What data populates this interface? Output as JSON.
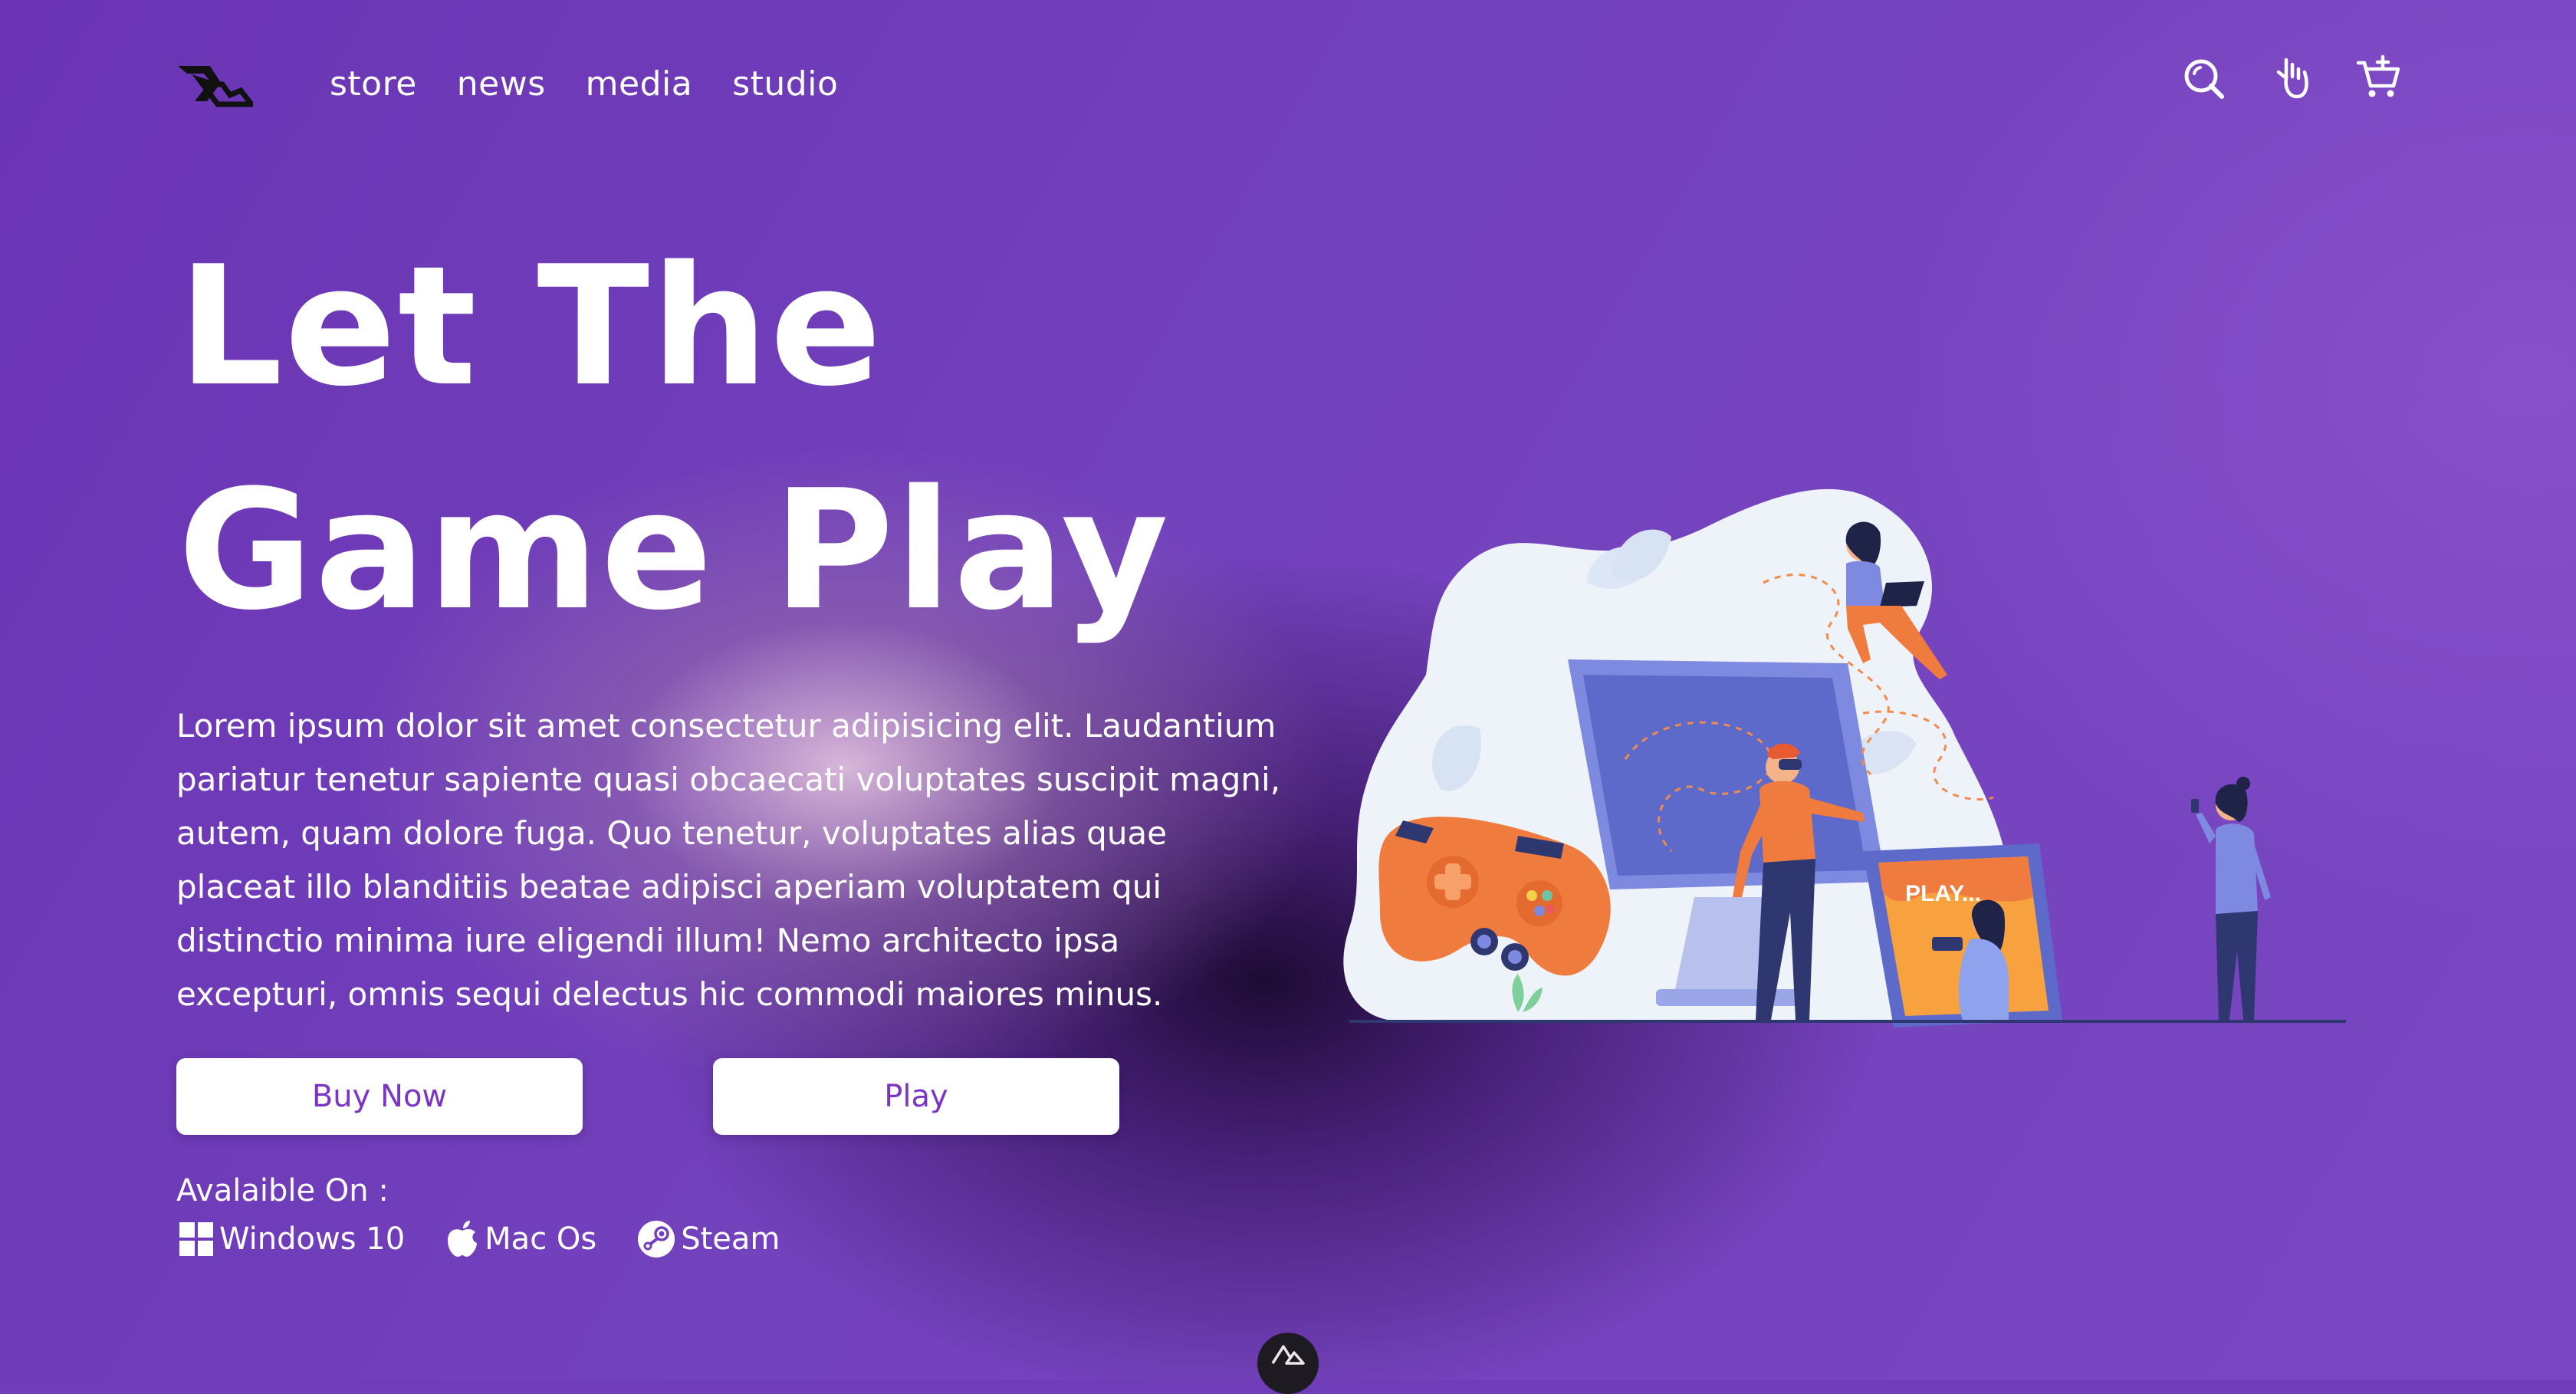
{
  "nav": {
    "items": [
      {
        "label": "store"
      },
      {
        "label": "news"
      },
      {
        "label": "media"
      },
      {
        "label": "studio"
      }
    ],
    "icons": [
      "search-icon",
      "hand-icon",
      "cart-add-icon"
    ]
  },
  "hero": {
    "title": "Let The Game Play",
    "description": "Lorem ipsum dolor sit amet consectetur adipisicing elit. Laudantium pariatur tenetur sapiente quasi obcaecati voluptates suscipit magni, autem, quam dolore fuga. Quo tenetur, voluptates alias quae placeat illo blanditiis beatae adipisci aperiam voluptatem qui distinctio minima iure eligendi illum! Nemo architecto ipsa excepturi, omnis sequi delectus hic commodi maiores minus.",
    "buy_label": "Buy Now",
    "play_label": "Play",
    "available_label": "Avalaible On :",
    "platforms": [
      {
        "label": "Windows 10",
        "icon": "windows-icon"
      },
      {
        "label": "Mac Os",
        "icon": "apple-icon"
      },
      {
        "label": "Steam",
        "icon": "steam-icon"
      }
    ]
  },
  "illustration": {
    "screen_text": "PLAY..."
  },
  "colors": {
    "background": "#7340bd",
    "accent": "#7a35c4",
    "illustration_orange": "#f07b3f",
    "illustration_blue": "#6f7ddc"
  }
}
